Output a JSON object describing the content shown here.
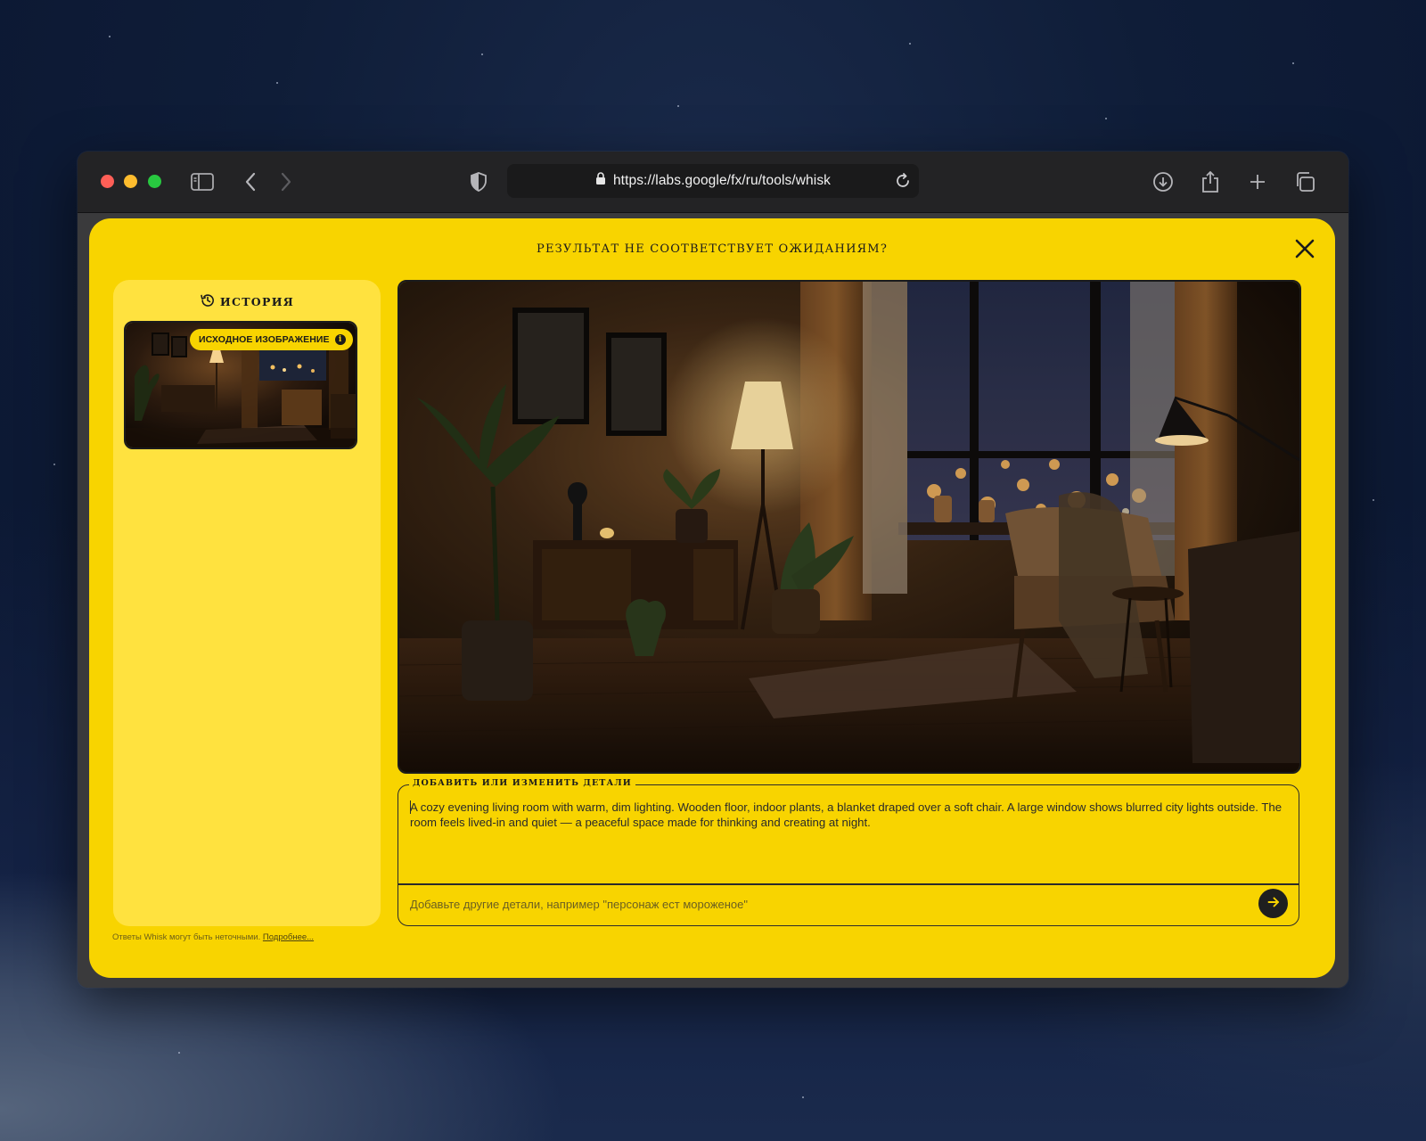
{
  "browser": {
    "url": "https://labs.google/fx/ru/tools/whisk"
  },
  "modal": {
    "title": "РЕЗУЛЬТАТ НЕ СООТВЕТСТВУЕТ ОЖИДАНИЯМ?",
    "close_icon": "close-icon"
  },
  "history": {
    "title": "ИСТОРИЯ",
    "icon": "history-icon",
    "items": [
      {
        "badge": "ИСХОДНОЕ ИЗОБРАЖЕНИЕ",
        "badge_icon": "info-icon"
      }
    ]
  },
  "details": {
    "legend": "ДОБАВИТЬ ИЛИ ИЗМЕНИТЬ ДЕТАЛИ",
    "prompt": "A cozy evening living room with warm, dim lighting. Wooden floor, indoor plants, a blanket draped over a soft chair. A large window shows blurred city lights outside. The room feels lived-in and quiet — a peaceful space made for thinking and creating at night.",
    "input_placeholder": "Добавьте другие детали, например \"персонаж ест мороженое\"",
    "send_icon": "arrow-right-icon"
  },
  "footer": {
    "disclaimer": "Ответы Whisk могут быть неточными.",
    "link": "Подробнее..."
  },
  "colors": {
    "modal_bg": "#f8d400",
    "panel_bg": "#ffe23f",
    "text": "#1b1b1b"
  }
}
